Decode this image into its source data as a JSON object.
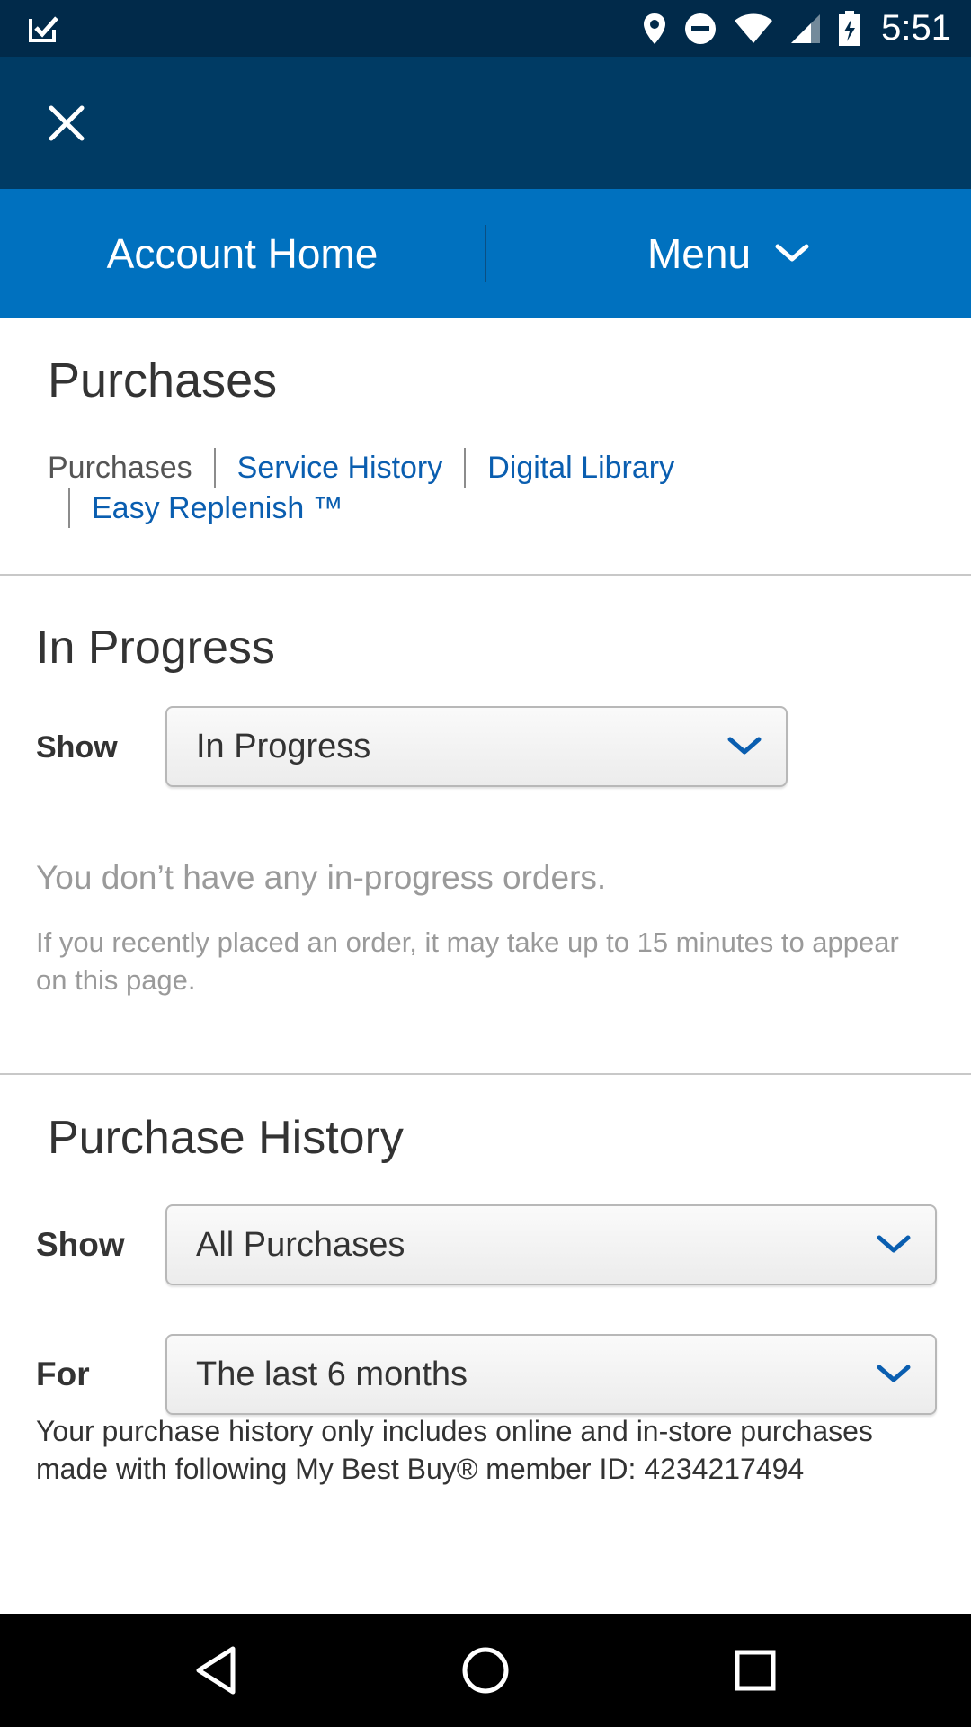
{
  "status_bar": {
    "time": "5:51",
    "icons": [
      "app-check-icon",
      "location-icon",
      "do-not-disturb-icon",
      "wifi-icon",
      "signal-icon",
      "battery-charging-icon"
    ]
  },
  "header": {
    "close_icon": "close-icon"
  },
  "nav": {
    "account_home": "Account Home",
    "menu": "Menu"
  },
  "purchases": {
    "title": "Purchases",
    "tabs": [
      {
        "label": "Purchases",
        "active": true
      },
      {
        "label": "Service History",
        "active": false
      },
      {
        "label": "Digital Library",
        "active": false
      },
      {
        "label": "Easy Replenish ™",
        "active": false
      }
    ]
  },
  "in_progress": {
    "title": "In Progress",
    "show_label": "Show",
    "show_value": "In Progress",
    "empty_message": "You don’t have any in-progress orders.",
    "empty_sub": "If you recently placed an order, it may take up to 15 minutes to appear on this page."
  },
  "purchase_history": {
    "title": "Purchase History",
    "show_label": "Show",
    "show_value": "All Purchases",
    "for_label": "For",
    "for_value": "The last 6 months",
    "note": "Your purchase history only includes online and in-store purchases made with following My Best Buy® member ID: 4234217494"
  },
  "colors": {
    "status_bar": "#012a4a",
    "header": "#003b64",
    "nav": "#0071bf",
    "link": "#0a5eb0",
    "chevron": "#0a5eb0"
  },
  "system_nav": {
    "icons": [
      "back-icon",
      "home-icon",
      "recents-icon"
    ]
  }
}
